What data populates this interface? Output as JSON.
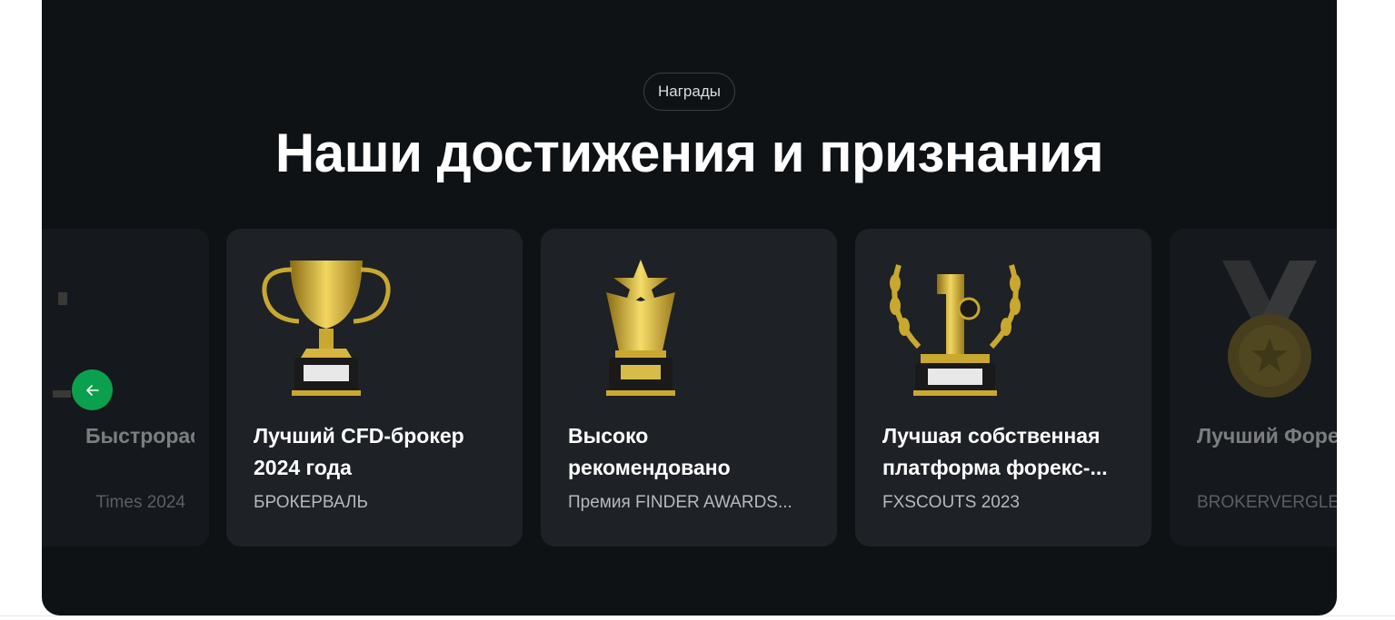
{
  "section": {
    "badge": "Награды",
    "heading": "Наши достижения и признания"
  },
  "cards": [
    {
      "title": "Быстрорастущие...",
      "subtitle": "Times 2024",
      "icon": "award-icon",
      "faded": true
    },
    {
      "title": "Лучший CFD-брокер 2024 года",
      "subtitle": "БРОКЕРВАЛЬ",
      "icon": "trophy-cup-icon"
    },
    {
      "title": "Высоко рекомендовано",
      "subtitle": "Премия FINDER AWARDS...",
      "icon": "star-trophy-icon"
    },
    {
      "title": "Лучшая собственная платформа форекс-...",
      "subtitle": "FXSCOUTS 2023",
      "icon": "number-one-laurel-icon"
    },
    {
      "title": "Лучший Форекс брокер",
      "subtitle": "BROKERVERGLEICH",
      "icon": "medal-icon",
      "faded": true
    }
  ],
  "nav": {
    "prev_icon": "arrow-left-icon"
  },
  "colors": {
    "background": "#0f1215",
    "card": "#1e2125",
    "accent": "#0aa04e",
    "gold": "#d4b13a"
  }
}
